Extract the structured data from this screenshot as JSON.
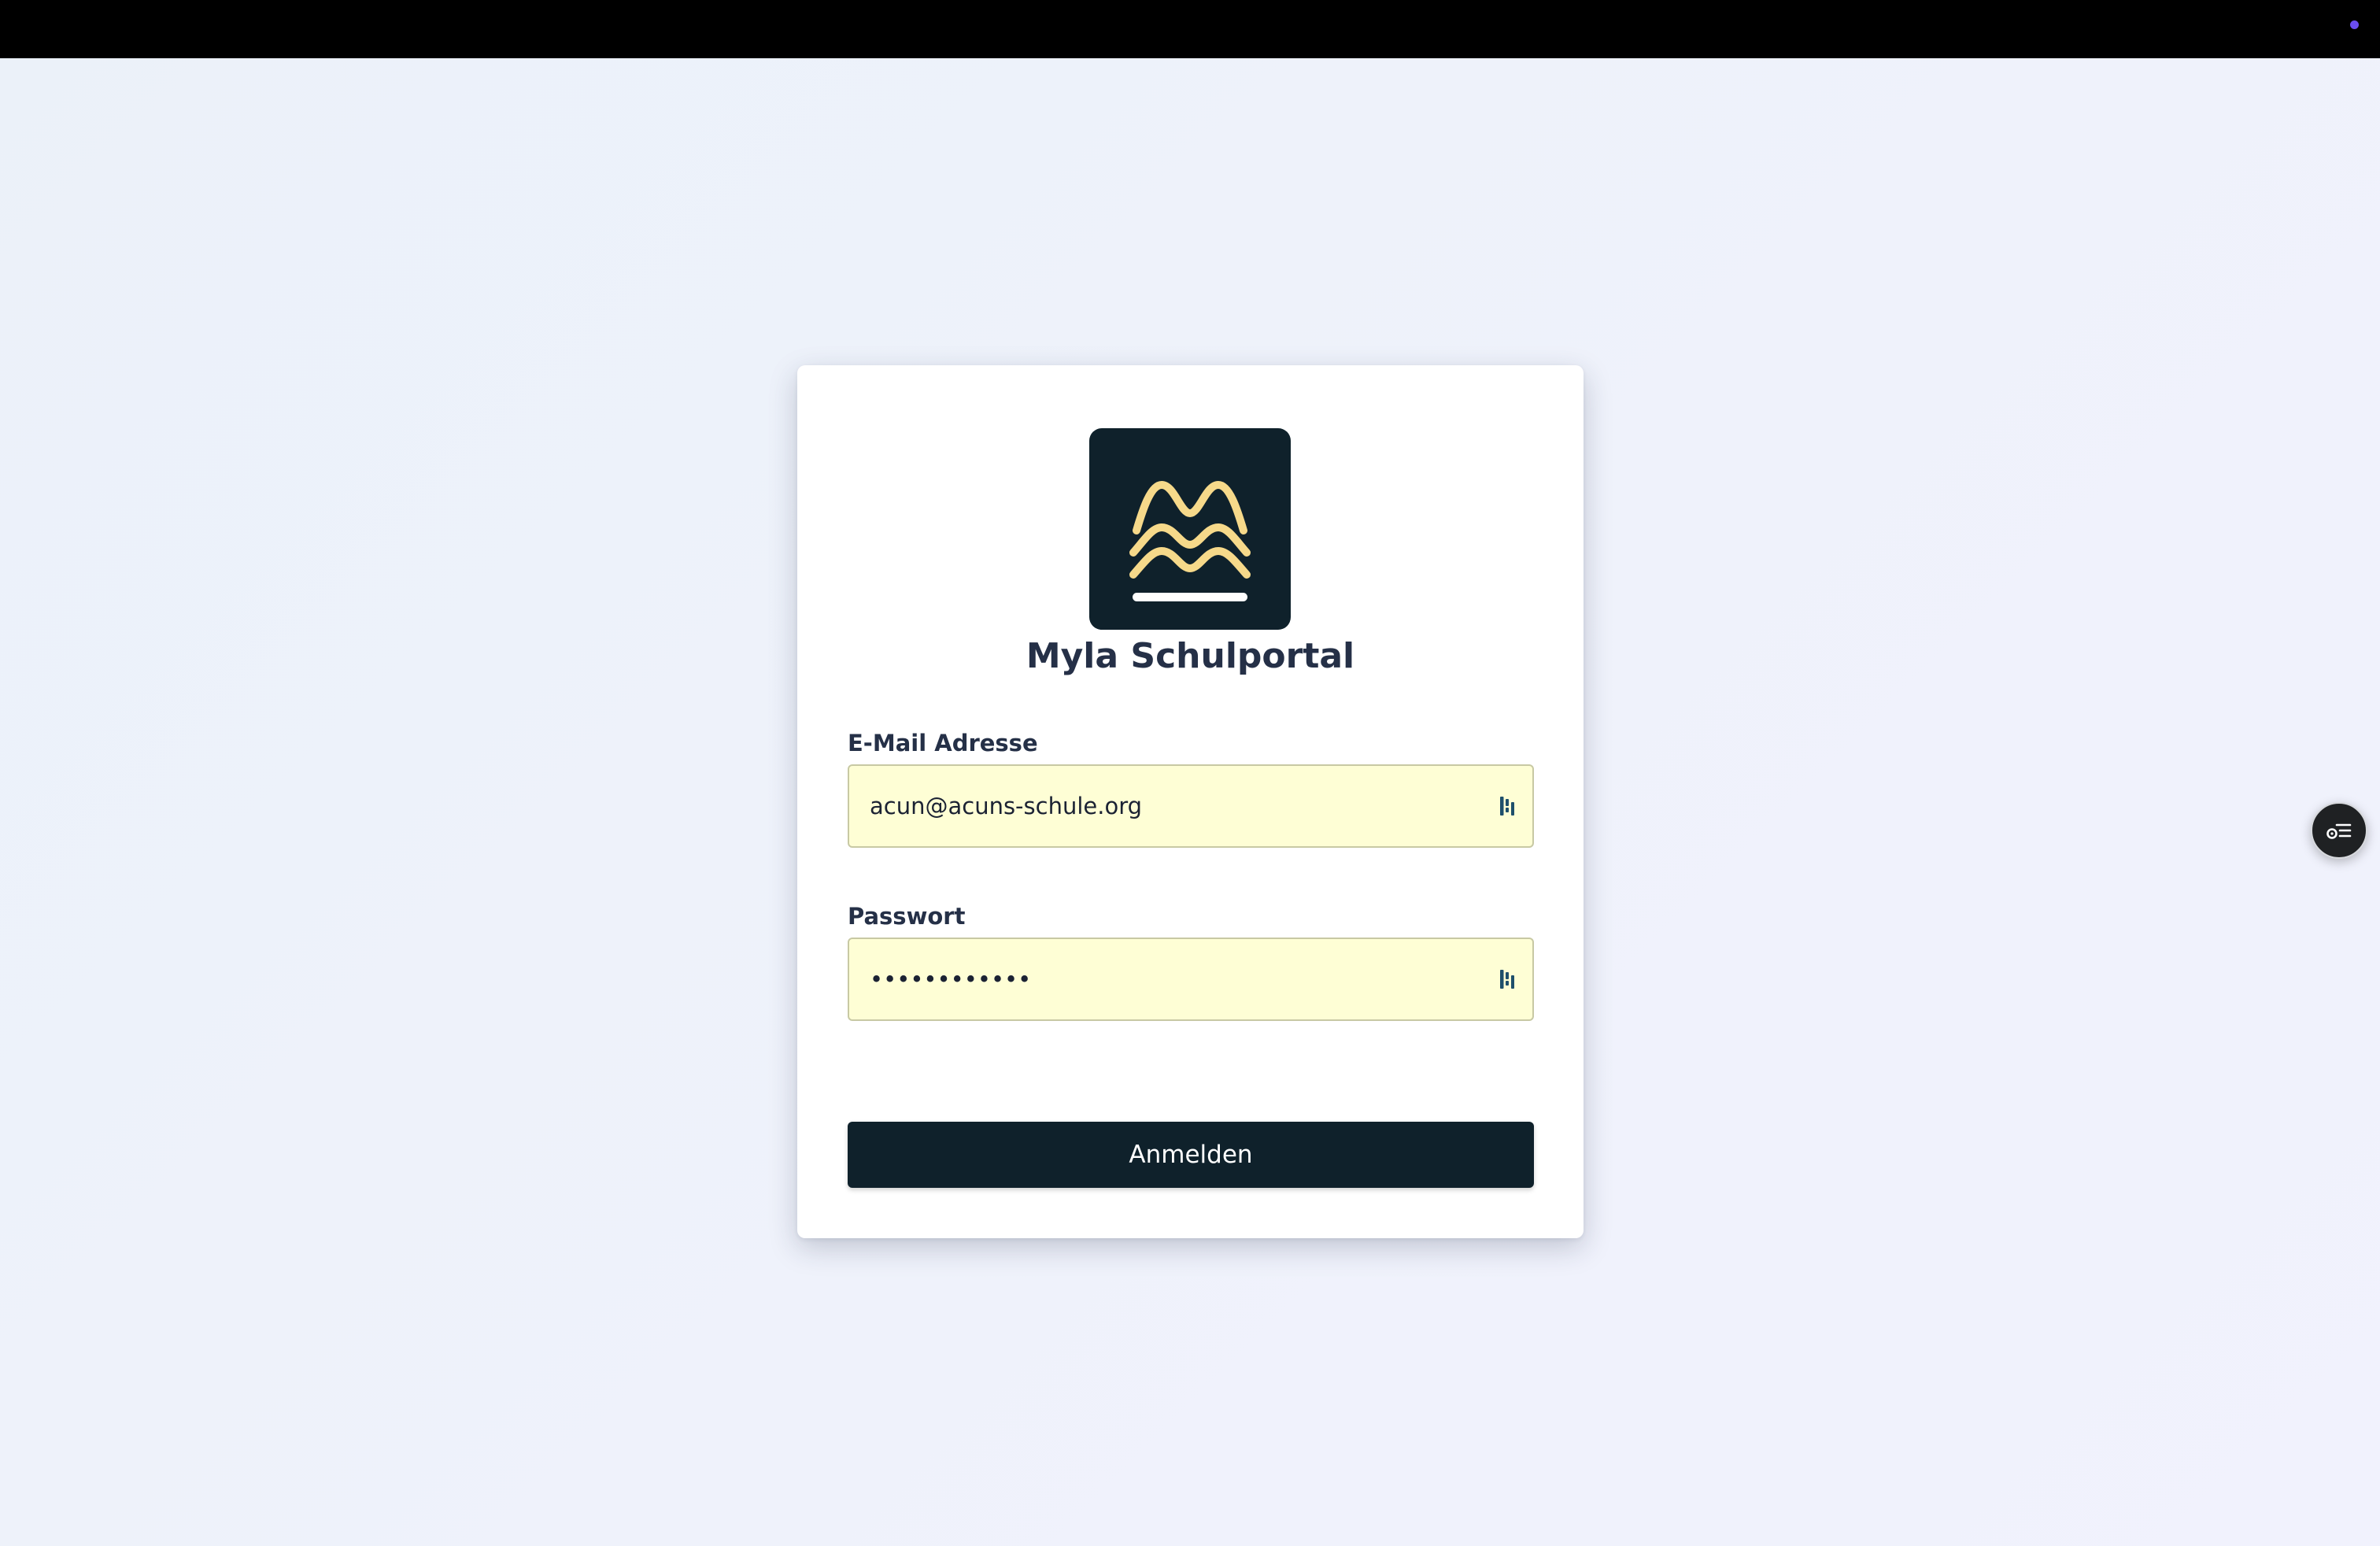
{
  "app": {
    "title": "Myla Schulportal"
  },
  "form": {
    "email_label": "E-Mail Adresse",
    "email_value": "acun@acuns-schule.org",
    "password_label": "Passwort",
    "password_value": "••••••••••••",
    "submit_label": "Anmelden"
  },
  "icons": {
    "logo": "waves-logo-icon",
    "password_manager": "password-manager-icon",
    "floating_action": "settings-list-icon",
    "status": "status-dot-icon"
  },
  "colors": {
    "logo_background": "#0f212b",
    "logo_waves": "#f6d98a",
    "button_background": "#0f212b",
    "input_background": "#fefed5",
    "status_dot": "#6a4cf0"
  }
}
